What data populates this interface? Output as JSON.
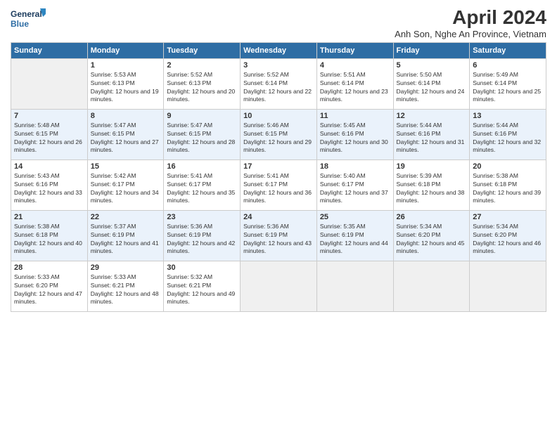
{
  "logo": {
    "line1": "General",
    "line2": "Blue"
  },
  "title": "April 2024",
  "subtitle": "Anh Son, Nghe An Province, Vietnam",
  "days_header": [
    "Sunday",
    "Monday",
    "Tuesday",
    "Wednesday",
    "Thursday",
    "Friday",
    "Saturday"
  ],
  "weeks": [
    [
      {
        "num": "",
        "empty": true
      },
      {
        "num": "1",
        "sunrise": "5:53 AM",
        "sunset": "6:13 PM",
        "daylight": "12 hours and 19 minutes."
      },
      {
        "num": "2",
        "sunrise": "5:52 AM",
        "sunset": "6:13 PM",
        "daylight": "12 hours and 20 minutes."
      },
      {
        "num": "3",
        "sunrise": "5:52 AM",
        "sunset": "6:14 PM",
        "daylight": "12 hours and 22 minutes."
      },
      {
        "num": "4",
        "sunrise": "5:51 AM",
        "sunset": "6:14 PM",
        "daylight": "12 hours and 23 minutes."
      },
      {
        "num": "5",
        "sunrise": "5:50 AM",
        "sunset": "6:14 PM",
        "daylight": "12 hours and 24 minutes."
      },
      {
        "num": "6",
        "sunrise": "5:49 AM",
        "sunset": "6:14 PM",
        "daylight": "12 hours and 25 minutes."
      }
    ],
    [
      {
        "num": "7",
        "sunrise": "5:48 AM",
        "sunset": "6:15 PM",
        "daylight": "12 hours and 26 minutes."
      },
      {
        "num": "8",
        "sunrise": "5:47 AM",
        "sunset": "6:15 PM",
        "daylight": "12 hours and 27 minutes."
      },
      {
        "num": "9",
        "sunrise": "5:47 AM",
        "sunset": "6:15 PM",
        "daylight": "12 hours and 28 minutes."
      },
      {
        "num": "10",
        "sunrise": "5:46 AM",
        "sunset": "6:15 PM",
        "daylight": "12 hours and 29 minutes."
      },
      {
        "num": "11",
        "sunrise": "5:45 AM",
        "sunset": "6:16 PM",
        "daylight": "12 hours and 30 minutes."
      },
      {
        "num": "12",
        "sunrise": "5:44 AM",
        "sunset": "6:16 PM",
        "daylight": "12 hours and 31 minutes."
      },
      {
        "num": "13",
        "sunrise": "5:44 AM",
        "sunset": "6:16 PM",
        "daylight": "12 hours and 32 minutes."
      }
    ],
    [
      {
        "num": "14",
        "sunrise": "5:43 AM",
        "sunset": "6:16 PM",
        "daylight": "12 hours and 33 minutes."
      },
      {
        "num": "15",
        "sunrise": "5:42 AM",
        "sunset": "6:17 PM",
        "daylight": "12 hours and 34 minutes."
      },
      {
        "num": "16",
        "sunrise": "5:41 AM",
        "sunset": "6:17 PM",
        "daylight": "12 hours and 35 minutes."
      },
      {
        "num": "17",
        "sunrise": "5:41 AM",
        "sunset": "6:17 PM",
        "daylight": "12 hours and 36 minutes."
      },
      {
        "num": "18",
        "sunrise": "5:40 AM",
        "sunset": "6:17 PM",
        "daylight": "12 hours and 37 minutes."
      },
      {
        "num": "19",
        "sunrise": "5:39 AM",
        "sunset": "6:18 PM",
        "daylight": "12 hours and 38 minutes."
      },
      {
        "num": "20",
        "sunrise": "5:38 AM",
        "sunset": "6:18 PM",
        "daylight": "12 hours and 39 minutes."
      }
    ],
    [
      {
        "num": "21",
        "sunrise": "5:38 AM",
        "sunset": "6:18 PM",
        "daylight": "12 hours and 40 minutes."
      },
      {
        "num": "22",
        "sunrise": "5:37 AM",
        "sunset": "6:19 PM",
        "daylight": "12 hours and 41 minutes."
      },
      {
        "num": "23",
        "sunrise": "5:36 AM",
        "sunset": "6:19 PM",
        "daylight": "12 hours and 42 minutes."
      },
      {
        "num": "24",
        "sunrise": "5:36 AM",
        "sunset": "6:19 PM",
        "daylight": "12 hours and 43 minutes."
      },
      {
        "num": "25",
        "sunrise": "5:35 AM",
        "sunset": "6:19 PM",
        "daylight": "12 hours and 44 minutes."
      },
      {
        "num": "26",
        "sunrise": "5:34 AM",
        "sunset": "6:20 PM",
        "daylight": "12 hours and 45 minutes."
      },
      {
        "num": "27",
        "sunrise": "5:34 AM",
        "sunset": "6:20 PM",
        "daylight": "12 hours and 46 minutes."
      }
    ],
    [
      {
        "num": "28",
        "sunrise": "5:33 AM",
        "sunset": "6:20 PM",
        "daylight": "12 hours and 47 minutes."
      },
      {
        "num": "29",
        "sunrise": "5:33 AM",
        "sunset": "6:21 PM",
        "daylight": "12 hours and 48 minutes."
      },
      {
        "num": "30",
        "sunrise": "5:32 AM",
        "sunset": "6:21 PM",
        "daylight": "12 hours and 49 minutes."
      },
      {
        "num": "",
        "empty": true
      },
      {
        "num": "",
        "empty": true
      },
      {
        "num": "",
        "empty": true
      },
      {
        "num": "",
        "empty": true
      }
    ]
  ]
}
